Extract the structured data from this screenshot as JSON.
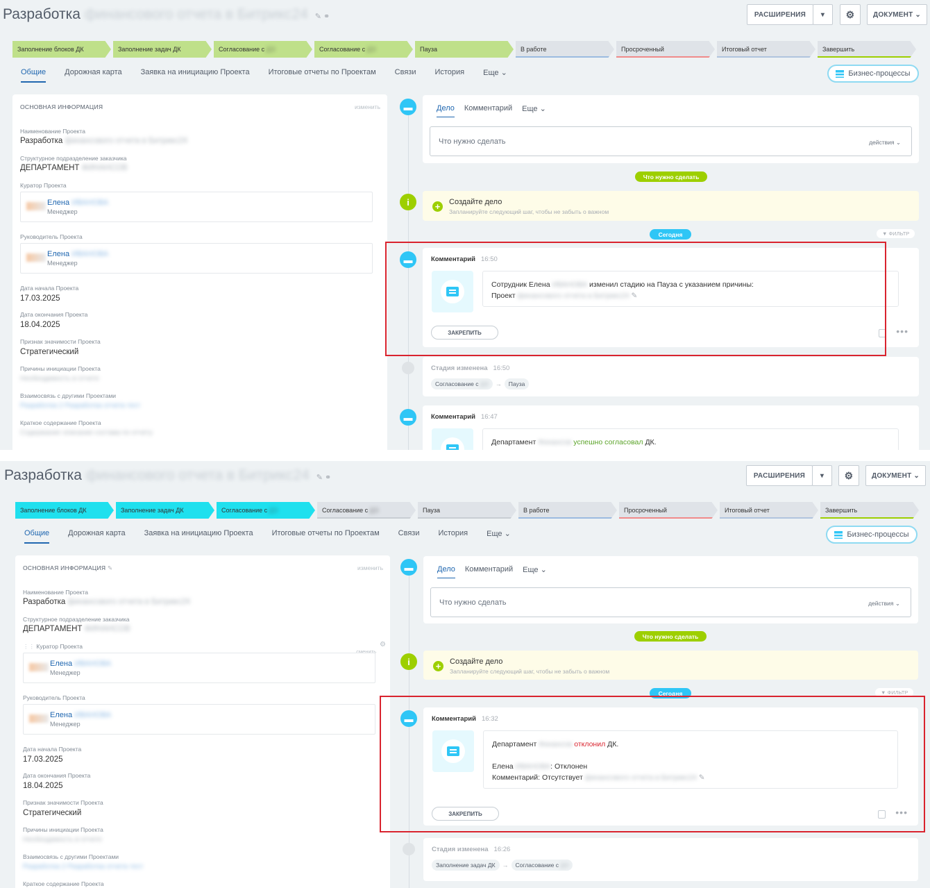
{
  "screens": [
    {
      "title": "Разработка",
      "title_blur": "финансового отчета в Битрикс24",
      "header_buttons": {
        "extensions": "РАСШИРЕНИЯ",
        "document": "ДОКУМЕНТ"
      },
      "stages": [
        {
          "label": "Заполнение блоков ДК",
          "color": "#bfe08a"
        },
        {
          "label": "Заполнение задач ДК",
          "color": "#bfe08a"
        },
        {
          "label": "Согласование с",
          "color": "#bfe08a"
        },
        {
          "label": "Согласование с",
          "color": "#bfe08a"
        },
        {
          "label": "Пауза",
          "color": "#bfe08a"
        },
        {
          "label": "В работе",
          "color": "#dfe3e8"
        },
        {
          "label": "Просроченный",
          "color": "#dfe3e8"
        },
        {
          "label": "Итоговый отчет",
          "color": "#dfe3e8"
        },
        {
          "label": "Завершить",
          "color": "#dfe3e8"
        }
      ],
      "tabs": [
        "Общие",
        "Дорожная карта",
        "Заявка на инициацию Проекта",
        "Итоговые отчеты по Проектам",
        "Связи",
        "История",
        "Еще"
      ],
      "bp_button": "Бизнес-процессы",
      "info": {
        "head": "ОСНОВНАЯ ИНФОРМАЦИЯ",
        "change": "изменить",
        "name_label": "Наименование Проекта",
        "name": "Разработка",
        "name_blur": "финансового отчета в Битрикс24",
        "dept_label": "Структурное подразделение заказчика",
        "dept": "ДЕПАРТАМЕНТ",
        "dept_blur": "ФИНАНСОВ",
        "curator_label": "Куратор Проекта",
        "curator": "Елена",
        "curator_blur": "ИВАНОВА",
        "curator_role": "Менеджер",
        "lead_label": "Руководитель Проекта",
        "lead": "Елена",
        "lead_blur": "ИВАНОВА",
        "lead_role": "Менеджер",
        "start_label": "Дата начала Проекта",
        "start": "17.03.2025",
        "end_label": "Дата окончания Проекта",
        "end": "18.04.2025",
        "sig_label": "Признак значимости Проекта",
        "sig": "Стратегический",
        "reasons_label": "Причины инициации Проекта",
        "reasons_blur": "Необходимость в отчете",
        "links_label": "Взаимосвязь с другими Проектами",
        "links_blur": "Разработка 2 Разработка отчета тест",
        "summary_label": "Краткое содержание Проекта",
        "summary_blur": "Содержание описание состава по отчету"
      },
      "activity": {
        "tab_case": "Дело",
        "tab_comment": "Комментарий",
        "tab_more": "Еще",
        "placeholder": "Что нужно сделать",
        "actions": "действия"
      },
      "pill_todo": "Что нужно сделать",
      "create": {
        "title": "Создайте дело",
        "hint": "Запланируйте следующий шаг, чтобы не забыть о важном"
      },
      "today": "Сегодня",
      "filter": "ФИЛЬТР",
      "comment": {
        "label": "Комментарий",
        "time": "16:50",
        "line1a": "Сотрудник Елена",
        "line1b": "изменил стадию на Пауза с указанием причины:",
        "line2": "Проект",
        "blur": "ИВАНОВА"
      },
      "pin": "ЗАКРЕПИТЬ",
      "stage_change": {
        "label": "Стадия изменена",
        "time": "16:50",
        "from": "Согласование с",
        "to": "Пауза"
      },
      "comment2": {
        "label": "Комментарий",
        "time": "16:47",
        "a": "Департамент",
        "b": "успешно согласовал",
        "c": "ДК."
      }
    },
    {
      "title": "Разработка",
      "title_blur": "финансового отчета в Битрикс24",
      "header_buttons": {
        "extensions": "РАСШИРЕНИЯ",
        "document": "ДОКУМЕНТ"
      },
      "stages": [
        {
          "label": "Заполнение блоков ДК",
          "color": "#1fe0ee"
        },
        {
          "label": "Заполнение задач ДК",
          "color": "#1fe0ee"
        },
        {
          "label": "Согласование с",
          "color": "#1fe0ee"
        },
        {
          "label": "Согласование с",
          "color": "#dfe3e8"
        },
        {
          "label": "Пауза",
          "color": "#dfe3e8"
        },
        {
          "label": "В работе",
          "color": "#dfe3e8"
        },
        {
          "label": "Просроченный",
          "color": "#dfe3e8"
        },
        {
          "label": "Итоговый отчет",
          "color": "#dfe3e8"
        },
        {
          "label": "Завершить",
          "color": "#dfe3e8"
        }
      ],
      "tabs": [
        "Общие",
        "Дорожная карта",
        "Заявка на инициацию Проекта",
        "Итоговые отчеты по Проектам",
        "Связи",
        "История",
        "Еще"
      ],
      "bp_button": "Бизнес-процессы",
      "info": {
        "head": "ОСНОВНАЯ ИНФОРМАЦИЯ",
        "change": "изменить",
        "curator_change": "сменить",
        "name_label": "Наименование Проекта",
        "name": "Разработка",
        "name_blur": "финансового отчета в Битрикс24",
        "dept_label": "Структурное подразделение заказчика",
        "dept": "ДЕПАРТАМЕНТ",
        "dept_blur": "ФИНАНСОВ",
        "curator_label": "Куратор Проекта",
        "curator": "Елена",
        "curator_blur": "ИВАНОВА",
        "curator_role": "Менеджер",
        "lead_label": "Руководитель Проекта",
        "lead": "Елена",
        "lead_blur": "ИВАНОВА",
        "lead_role": "Менеджер",
        "start_label": "Дата начала Проекта",
        "start": "17.03.2025",
        "end_label": "Дата окончания Проекта",
        "end": "18.04.2025",
        "sig_label": "Признак значимости Проекта",
        "sig": "Стратегический",
        "reasons_label": "Причины инициации Проекта",
        "reasons_blur": "Необходимость в отчете",
        "links_label": "Взаимосвязь с другими Проектами",
        "links_blur": "Разработка 2 Разработка отчета тест",
        "summary_label": "Краткое содержание Проекта"
      },
      "activity": {
        "tab_case": "Дело",
        "tab_comment": "Комментарий",
        "tab_more": "Еще",
        "placeholder": "Что нужно сделать",
        "actions": "действия"
      },
      "pill_todo": "Что нужно сделать",
      "create": {
        "title": "Создайте дело",
        "hint": "Запланируйте следующий шаг, чтобы не забыть о важном"
      },
      "today": "Сегодня",
      "filter": "ФИЛЬТР",
      "comment": {
        "label": "Комментарий",
        "time": "16:32",
        "a": "Департамент",
        "b": "отклонил",
        "c": "ДК.",
        "line2a": "Елена",
        "line2b": ": Отклонен",
        "line3": "Комментарий: Отсутствует",
        "blur": "ИВАНОВА"
      },
      "pin": "ЗАКРЕПИТЬ",
      "stage_change": {
        "label": "Стадия изменена",
        "time": "16:26",
        "from": "Заполнение задач ДК",
        "to": "Согласование с"
      }
    }
  ]
}
